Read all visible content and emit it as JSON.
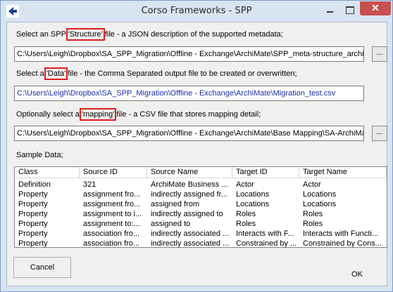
{
  "window": {
    "title": "Corso Frameworks - SPP",
    "close_glyph": "✕"
  },
  "structure": {
    "label_before": "Select an SPP ",
    "label_highlight": "'Structure'",
    "label_after": " file - a JSON description of the supported metadata;",
    "value": "C:\\Users\\Leigh\\Dropbox\\SA_SPP_Migration\\Offline - Exchange\\ArchiMate\\SPP_meta-structure_archi.json",
    "browse_label": "..."
  },
  "data_file": {
    "label_before": "Select a ",
    "label_highlight": "'Data'",
    "label_after": " file - the Comma Separated output file to be created or overwritten;",
    "value": "C:\\Users\\Leigh\\Dropbox\\SA_SPP_Migration\\Offline - Exchange\\ArchiMate\\Migration_test.csv"
  },
  "mapping": {
    "label_before": "Optionally select a ",
    "label_highlight": "'mapping'",
    "label_after": " file - a CSV file that stores mapping detail;",
    "value": "C:\\Users\\Leigh\\Dropbox\\SA_SPP_Migration\\Offline - Exchange\\ArchiMate\\Base Mapping\\SA-ArchiMate",
    "browse_label": "..."
  },
  "sample": {
    "label": "Sample Data;",
    "columns": [
      "Class",
      "Source ID",
      "Source Name",
      "Target ID",
      "Target Name"
    ],
    "rows": [
      [
        "Definition",
        "321",
        "ArchiMate Business ...",
        "Actor",
        "Actor"
      ],
      [
        "Property",
        "assignment fro...",
        "indirectly assigned fr...",
        "Locations",
        "Locations"
      ],
      [
        "Property",
        "assignment fro...",
        "assigned from",
        "Locations",
        "Locations"
      ],
      [
        "Property",
        "assignment to i...",
        "indirectly assigned to",
        "Roles",
        "Roles"
      ],
      [
        "Property",
        "assignment to:...",
        "assigned to",
        "Roles",
        "Roles"
      ],
      [
        "Property",
        "association fro...",
        "indirectly associated ...",
        "Interacts with F...",
        "Interacts with Functi..."
      ],
      [
        "Property",
        "association fro...",
        "indirectly associated ...",
        "Constrained by ...",
        "Constrained by Cons..."
      ]
    ]
  },
  "buttons": {
    "cancel": "Cancel",
    "ok": "OK"
  },
  "colors": {
    "highlight": "#e01b1b",
    "path_blue": "#1c2fa8",
    "close_red": "#c75050"
  }
}
